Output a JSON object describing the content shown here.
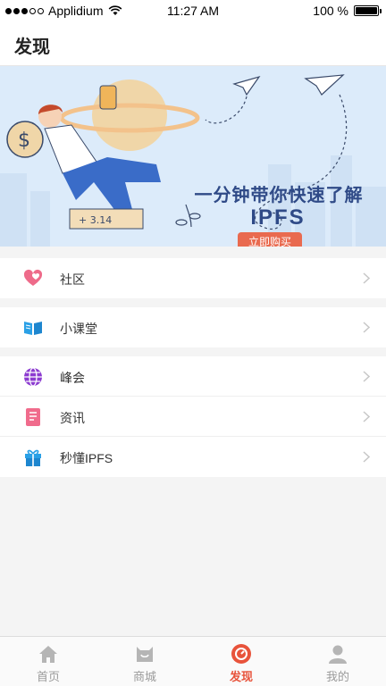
{
  "status_bar": {
    "carrier": "Applidium",
    "time": "11:27 AM",
    "battery": "100 %"
  },
  "header": {
    "title": "发现"
  },
  "banner": {
    "title": "一分钟带你快速了解",
    "subtitle": "IPFS",
    "button_label": "立即购买"
  },
  "groups": [
    [
      {
        "label": "社区",
        "icon": "heart-icon"
      }
    ],
    [
      {
        "label": "小课堂",
        "icon": "book-icon"
      }
    ],
    [
      {
        "label": "峰会",
        "icon": "globe-icon"
      },
      {
        "label": "资讯",
        "icon": "news-icon"
      },
      {
        "label": "秒懂IPFS",
        "icon": "gift-icon"
      }
    ]
  ],
  "tab_bar": {
    "active": "发现",
    "tabs": [
      {
        "label": "首页",
        "icon": "home-icon"
      },
      {
        "label": "商城",
        "icon": "shop-icon"
      },
      {
        "label": "发现",
        "icon": "discover-icon"
      },
      {
        "label": "我的",
        "icon": "profile-icon"
      }
    ]
  },
  "colors": {
    "accent": "#e8533b",
    "banner_bg": "#dcebfa",
    "banner_text": "#2f4a87",
    "button": "#e96a4f"
  }
}
